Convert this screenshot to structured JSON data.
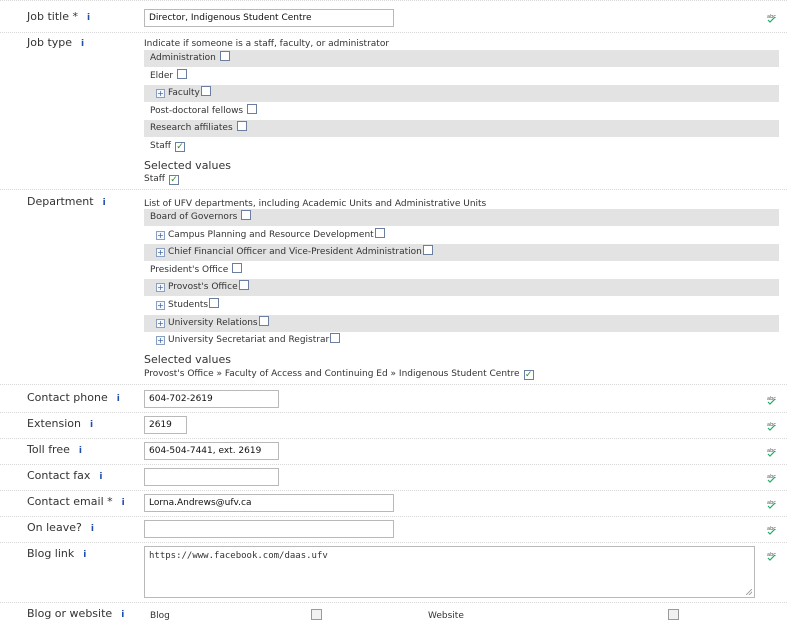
{
  "fields": {
    "job_title": {
      "label": "Job title *",
      "value": "Director, Indigenous Student Centre"
    },
    "job_type": {
      "label": "Job type",
      "help": "Indicate if someone is a staff, faculty, or administrator",
      "options": [
        {
          "label": "Administration",
          "checked": false,
          "expandable": false
        },
        {
          "label": "Elder",
          "checked": false,
          "expandable": false
        },
        {
          "label": "Faculty",
          "checked": false,
          "expandable": true
        },
        {
          "label": "Post-doctoral fellows",
          "checked": false,
          "expandable": false
        },
        {
          "label": "Research affiliates",
          "checked": false,
          "expandable": false
        },
        {
          "label": "Staff",
          "checked": true,
          "expandable": false
        }
      ],
      "selected_header": "Selected values",
      "selected": "Staff"
    },
    "department": {
      "label": "Department",
      "help": "List of UFV departments, including Academic Units and Administrative Units",
      "options": [
        {
          "label": "Board of Governors",
          "checked": false,
          "expandable": false
        },
        {
          "label": "Campus Planning and Resource Development",
          "checked": false,
          "expandable": true
        },
        {
          "label": "Chief Financial Officer and Vice-President Administration",
          "checked": false,
          "expandable": true
        },
        {
          "label": "President's Office",
          "checked": false,
          "expandable": false
        },
        {
          "label": "Provost's Office",
          "checked": false,
          "expandable": true
        },
        {
          "label": "Students",
          "checked": false,
          "expandable": true
        },
        {
          "label": "University Relations",
          "checked": false,
          "expandable": true
        },
        {
          "label": "University Secretariat and Registrar",
          "checked": false,
          "expandable": true
        }
      ],
      "selected_header": "Selected values",
      "selected": "Provost's Office » Faculty of Access and Continuing Ed » Indigenous Student Centre"
    },
    "contact_phone": {
      "label": "Contact phone",
      "value": "604-702-2619"
    },
    "extension": {
      "label": "Extension",
      "value": "2619"
    },
    "toll_free": {
      "label": "Toll free",
      "value": "604-504-7441, ext. 2619"
    },
    "contact_fax": {
      "label": "Contact fax",
      "value": ""
    },
    "contact_email": {
      "label": "Contact email *",
      "value": "Lorna.Andrews@ufv.ca"
    },
    "on_leave": {
      "label": "On leave?",
      "value": ""
    },
    "blog_link": {
      "label": "Blog link",
      "value": "https://www.facebook.com/daas.ufv"
    },
    "blog_or_website": {
      "label": "Blog or website",
      "blog_label": "Blog",
      "website_label": "Website"
    }
  },
  "info_icon_glyph": "i",
  "spellcheck_icon": "spellcheck-icon",
  "expand_glyph": "+",
  "check_glyph": "✓",
  "colors": {
    "info": "#1f4fa8",
    "shade_row": "#e3e3e3",
    "check": "#2a8a2a"
  }
}
